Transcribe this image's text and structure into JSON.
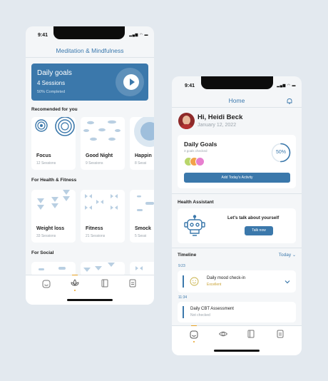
{
  "colors": {
    "accent": "#3b78ab",
    "gold": "#e6a020",
    "background": "#e3e9ef"
  },
  "screen1": {
    "status_time": "9:41",
    "nav_title": "Meditation & Mindfulness",
    "daily_goals": {
      "title": "Daily goals",
      "sessions": "4 Sessions",
      "progress": "50% Completed",
      "play_icon": "play-icon"
    },
    "recommended": {
      "heading": "Recomended for you",
      "cards": [
        {
          "title": "Focus",
          "sessions": "12 Sessions"
        },
        {
          "title": "Good Night",
          "sessions": "9 Sessions"
        },
        {
          "title": "Happin",
          "sessions": "8 Sessi"
        }
      ]
    },
    "health_fitness": {
      "heading": "For Health & Fitness",
      "cards": [
        {
          "title": "Weight loss",
          "sessions": "33 Sessions"
        },
        {
          "title": "Fitness",
          "sessions": "21 Sessions"
        },
        {
          "title": "Smock",
          "sessions": "5 Sessi"
        }
      ]
    },
    "social": {
      "heading": "For Social"
    },
    "tabs": [
      "home-icon",
      "lotus-icon",
      "book-icon",
      "clipboard-icon"
    ]
  },
  "screen2": {
    "status_time": "9:41",
    "nav_title": "Home",
    "bell_icon": "bell-icon",
    "greeting": "Hi, Heidi Beck",
    "date": "January 12, 2022",
    "daily_goals": {
      "title": "Daily Goals",
      "subtitle": "3 goals checked",
      "percent": "50%",
      "percent_value": 0.5,
      "button": "Add Today's Activity"
    },
    "health_assistant": {
      "heading": "Health Assistant",
      "prompt": "Let's talk about yourself",
      "button": "Talk now",
      "robot_icon": "robot-icon"
    },
    "timeline": {
      "heading": "Timeline",
      "filter": "Today",
      "entries": [
        {
          "time": "9:23",
          "title": "Daily mood check-in",
          "status": "Excellent"
        },
        {
          "time": "11:34",
          "title": "Daily CBT Assessment",
          "status": "Not checked"
        }
      ]
    },
    "tabs": [
      "home-icon",
      "eye-icon",
      "book-icon",
      "clipboard-icon"
    ]
  }
}
